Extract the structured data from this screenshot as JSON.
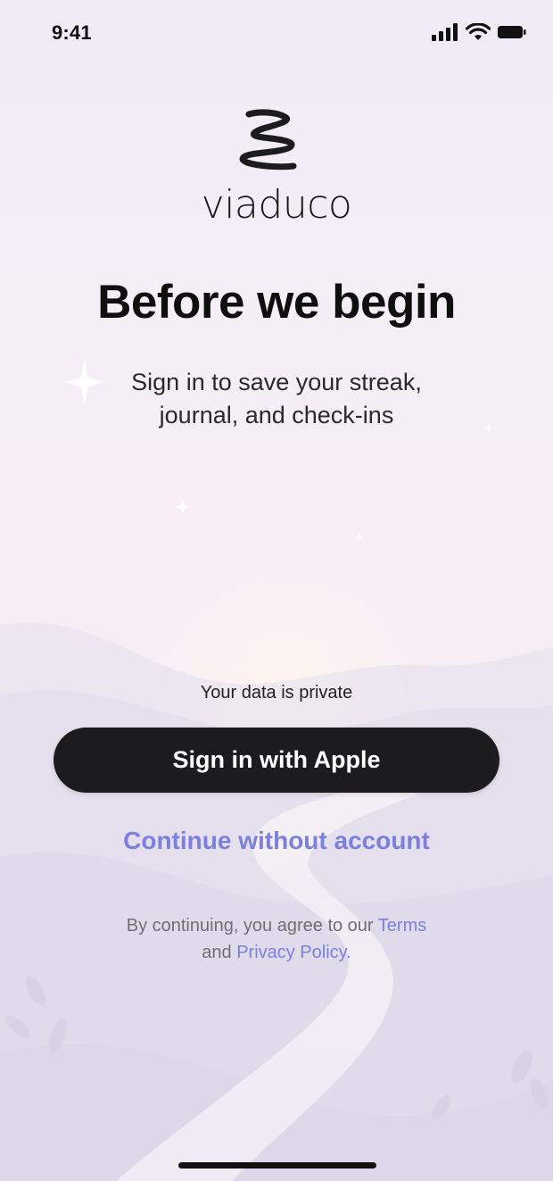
{
  "status_bar": {
    "time": "9:41",
    "icons": [
      "cellular-signal-icon",
      "wifi-icon",
      "battery-icon"
    ]
  },
  "brand": {
    "logo_icon": "squiggle-logo-icon",
    "name": "viaduco"
  },
  "header": {
    "title": "Before we begin",
    "subtitle_line1": "Sign in to save your streak,",
    "subtitle_line2": "journal, and check-ins"
  },
  "auth": {
    "privacy_note": "Your data is private",
    "apple_button_label": "Sign in with Apple",
    "continue_label": "Continue without account"
  },
  "legal": {
    "prefix": "By continuing, you agree to our",
    "terms_label": "Terms",
    "conjunction": "and",
    "privacy_label": "Privacy Policy."
  },
  "colors": {
    "accent": "#7b7fde",
    "button_bg": "#1c1c1e",
    "text_primary": "#0f0f0f",
    "text_muted": "#6e6e74"
  }
}
